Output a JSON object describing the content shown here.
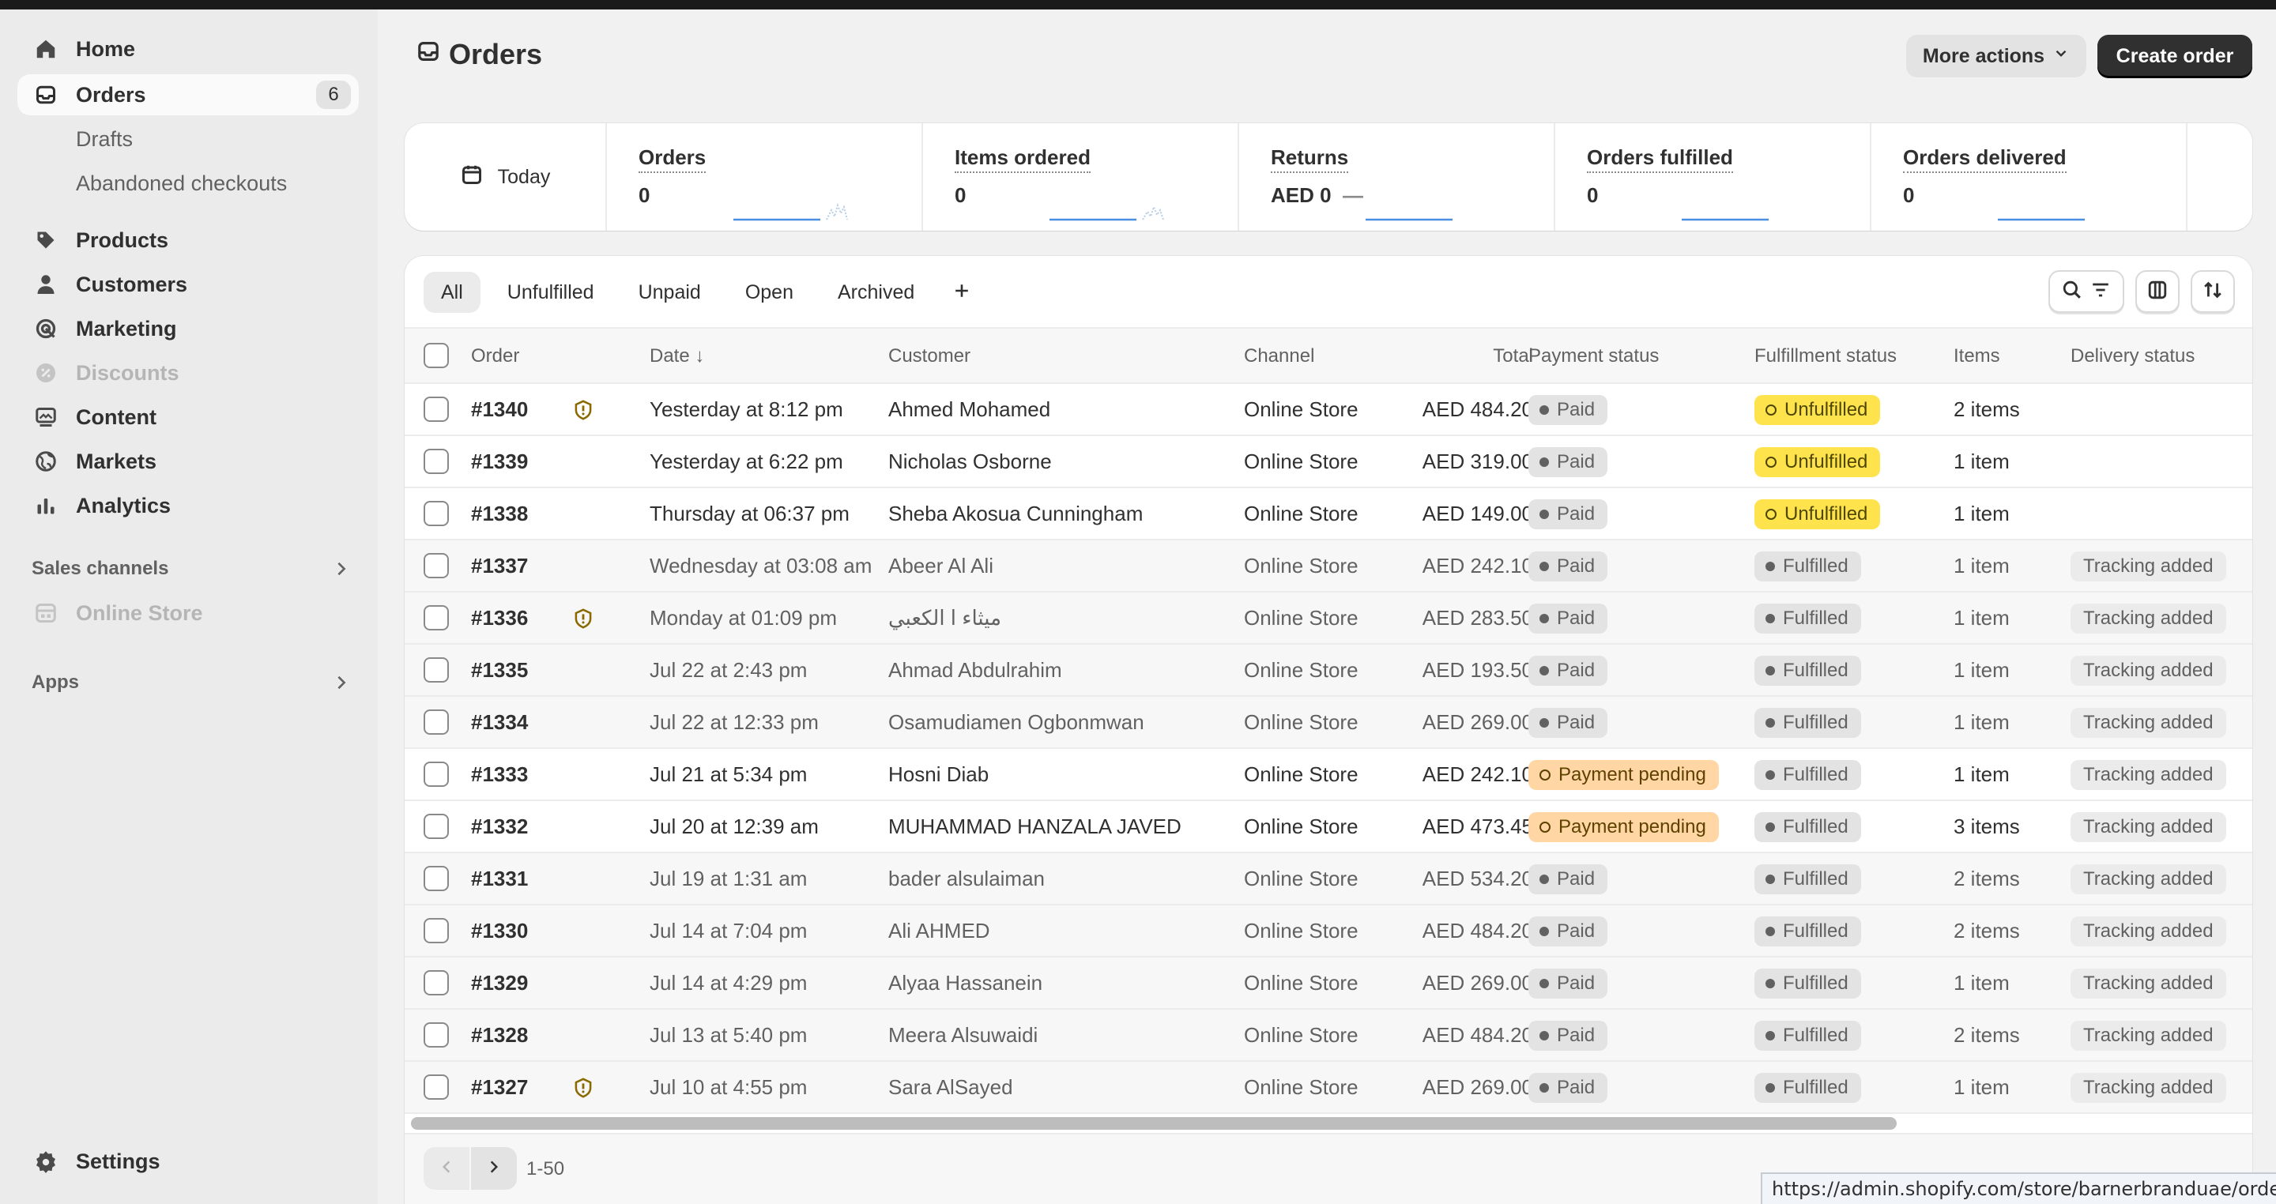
{
  "sidebar": {
    "items": [
      {
        "label": "Home",
        "icon": "home-icon"
      },
      {
        "label": "Orders",
        "icon": "inbox-icon",
        "badge": "6"
      },
      {
        "label": "Drafts"
      },
      {
        "label": "Abandoned checkouts"
      },
      {
        "label": "Products",
        "icon": "tag-icon"
      },
      {
        "label": "Customers",
        "icon": "person-icon"
      },
      {
        "label": "Marketing",
        "icon": "target-icon"
      },
      {
        "label": "Discounts",
        "icon": "discount-icon"
      },
      {
        "label": "Content",
        "icon": "content-icon"
      },
      {
        "label": "Markets",
        "icon": "globe-icon"
      },
      {
        "label": "Analytics",
        "icon": "bar-chart-icon"
      }
    ],
    "sales_channels": "Sales channels",
    "online_store": "Online Store",
    "apps": "Apps",
    "settings": "Settings"
  },
  "header": {
    "title": "Orders",
    "more_actions": "More actions",
    "create_order": "Create order"
  },
  "metrics": {
    "today": "Today",
    "items": [
      {
        "label": "Orders",
        "value": "0"
      },
      {
        "label": "Items ordered",
        "value": "0"
      },
      {
        "label": "Returns",
        "value": "AED 0",
        "extra": "—"
      },
      {
        "label": "Orders fulfilled",
        "value": "0"
      },
      {
        "label": "Orders delivered",
        "value": "0"
      }
    ]
  },
  "tabs": [
    "All",
    "Unfulfilled",
    "Unpaid",
    "Open",
    "Archived"
  ],
  "columns": {
    "order": "Order",
    "date": "Date ↓",
    "customer": "Customer",
    "channel": "Channel",
    "total": "Total",
    "payment": "Payment status",
    "fulfillment": "Fulfillment status",
    "items": "Items",
    "delivery": "Delivery status"
  },
  "orders": [
    {
      "order": "#1340",
      "flag": true,
      "date": "Yesterday at 8:12 pm",
      "customer": "Ahmed Mohamed",
      "channel": "Online Store",
      "total": "AED 484.20",
      "payment": "Paid",
      "fulfillment": "Unfulfilled",
      "items": "2 items",
      "delivery": "",
      "unread": true
    },
    {
      "order": "#1339",
      "flag": false,
      "date": "Yesterday at 6:22 pm",
      "customer": "Nicholas Osborne",
      "channel": "Online Store",
      "total": "AED 319.00",
      "payment": "Paid",
      "fulfillment": "Unfulfilled",
      "items": "1 item",
      "delivery": "",
      "unread": true
    },
    {
      "order": "#1338",
      "flag": false,
      "date": "Thursday at 06:37 pm",
      "customer": "Sheba Akosua Cunningham",
      "channel": "Online Store",
      "total": "AED 149.00",
      "payment": "Paid",
      "fulfillment": "Unfulfilled",
      "items": "1 item",
      "delivery": "",
      "unread": true
    },
    {
      "order": "#1337",
      "flag": false,
      "date": "Wednesday at 03:08 am",
      "customer": "Abeer Al Ali",
      "channel": "Online Store",
      "total": "AED 242.10",
      "payment": "Paid",
      "fulfillment": "Fulfilled",
      "items": "1 item",
      "delivery": "Tracking added",
      "unread": false
    },
    {
      "order": "#1336",
      "flag": true,
      "date": "Monday at 01:09 pm",
      "customer": "ميثاء ا الكعبي",
      "channel": "Online Store",
      "total": "AED 283.50",
      "payment": "Paid",
      "fulfillment": "Fulfilled",
      "items": "1 item",
      "delivery": "Tracking added",
      "unread": false
    },
    {
      "order": "#1335",
      "flag": false,
      "date": "Jul 22 at 2:43 pm",
      "customer": "Ahmad Abdulrahim",
      "channel": "Online Store",
      "total": "AED 193.50",
      "payment": "Paid",
      "fulfillment": "Fulfilled",
      "items": "1 item",
      "delivery": "Tracking added",
      "unread": false
    },
    {
      "order": "#1334",
      "flag": false,
      "date": "Jul 22 at 12:33 pm",
      "customer": "Osamudiamen Ogbonmwan",
      "channel": "Online Store",
      "total": "AED 269.00",
      "payment": "Paid",
      "fulfillment": "Fulfilled",
      "items": "1 item",
      "delivery": "Tracking added",
      "unread": false
    },
    {
      "order": "#1333",
      "flag": false,
      "date": "Jul 21 at 5:34 pm",
      "customer": "Hosni Diab",
      "channel": "Online Store",
      "total": "AED 242.10",
      "payment": "Payment pending",
      "fulfillment": "Fulfilled",
      "items": "1 item",
      "delivery": "Tracking added",
      "unread": true
    },
    {
      "order": "#1332",
      "flag": false,
      "date": "Jul 20 at 12:39 am",
      "customer": "MUHAMMAD HANZALA JAVED",
      "channel": "Online Store",
      "total": "AED 473.45",
      "payment": "Payment pending",
      "fulfillment": "Fulfilled",
      "items": "3 items",
      "delivery": "Tracking added",
      "unread": true
    },
    {
      "order": "#1331",
      "flag": false,
      "date": "Jul 19 at 1:31 am",
      "customer": "bader alsulaiman",
      "channel": "Online Store",
      "total": "AED 534.20",
      "payment": "Paid",
      "fulfillment": "Fulfilled",
      "items": "2 items",
      "delivery": "Tracking added",
      "unread": false
    },
    {
      "order": "#1330",
      "flag": false,
      "date": "Jul 14 at 7:04 pm",
      "customer": "Ali AHMED",
      "channel": "Online Store",
      "total": "AED 484.20",
      "payment": "Paid",
      "fulfillment": "Fulfilled",
      "items": "2 items",
      "delivery": "Tracking added",
      "unread": false
    },
    {
      "order": "#1329",
      "flag": false,
      "date": "Jul 14 at 4:29 pm",
      "customer": "Alyaa Hassanein",
      "channel": "Online Store",
      "total": "AED 269.00",
      "payment": "Paid",
      "fulfillment": "Fulfilled",
      "items": "1 item",
      "delivery": "Tracking added",
      "unread": false
    },
    {
      "order": "#1328",
      "flag": false,
      "date": "Jul 13 at 5:40 pm",
      "customer": "Meera Alsuwaidi",
      "channel": "Online Store",
      "total": "AED 484.20",
      "payment": "Paid",
      "fulfillment": "Fulfilled",
      "items": "2 items",
      "delivery": "Tracking added",
      "unread": false
    },
    {
      "order": "#1327",
      "flag": true,
      "date": "Jul 10 at 4:55 pm",
      "customer": "Sara AlSayed",
      "channel": "Online Store",
      "total": "AED 269.00",
      "payment": "Paid",
      "fulfillment": "Fulfilled",
      "items": "1 item",
      "delivery": "Tracking added",
      "unread": false
    }
  ],
  "pagination": {
    "range": "1-50"
  },
  "status_url": "https://admin.shopify.com/store/barnerbranduae/orders",
  "colors": {
    "accent": "#303030",
    "unfulfilled": "#ffe34d",
    "pending": "#ffd6a4",
    "sparkline": "#4a90e2"
  }
}
